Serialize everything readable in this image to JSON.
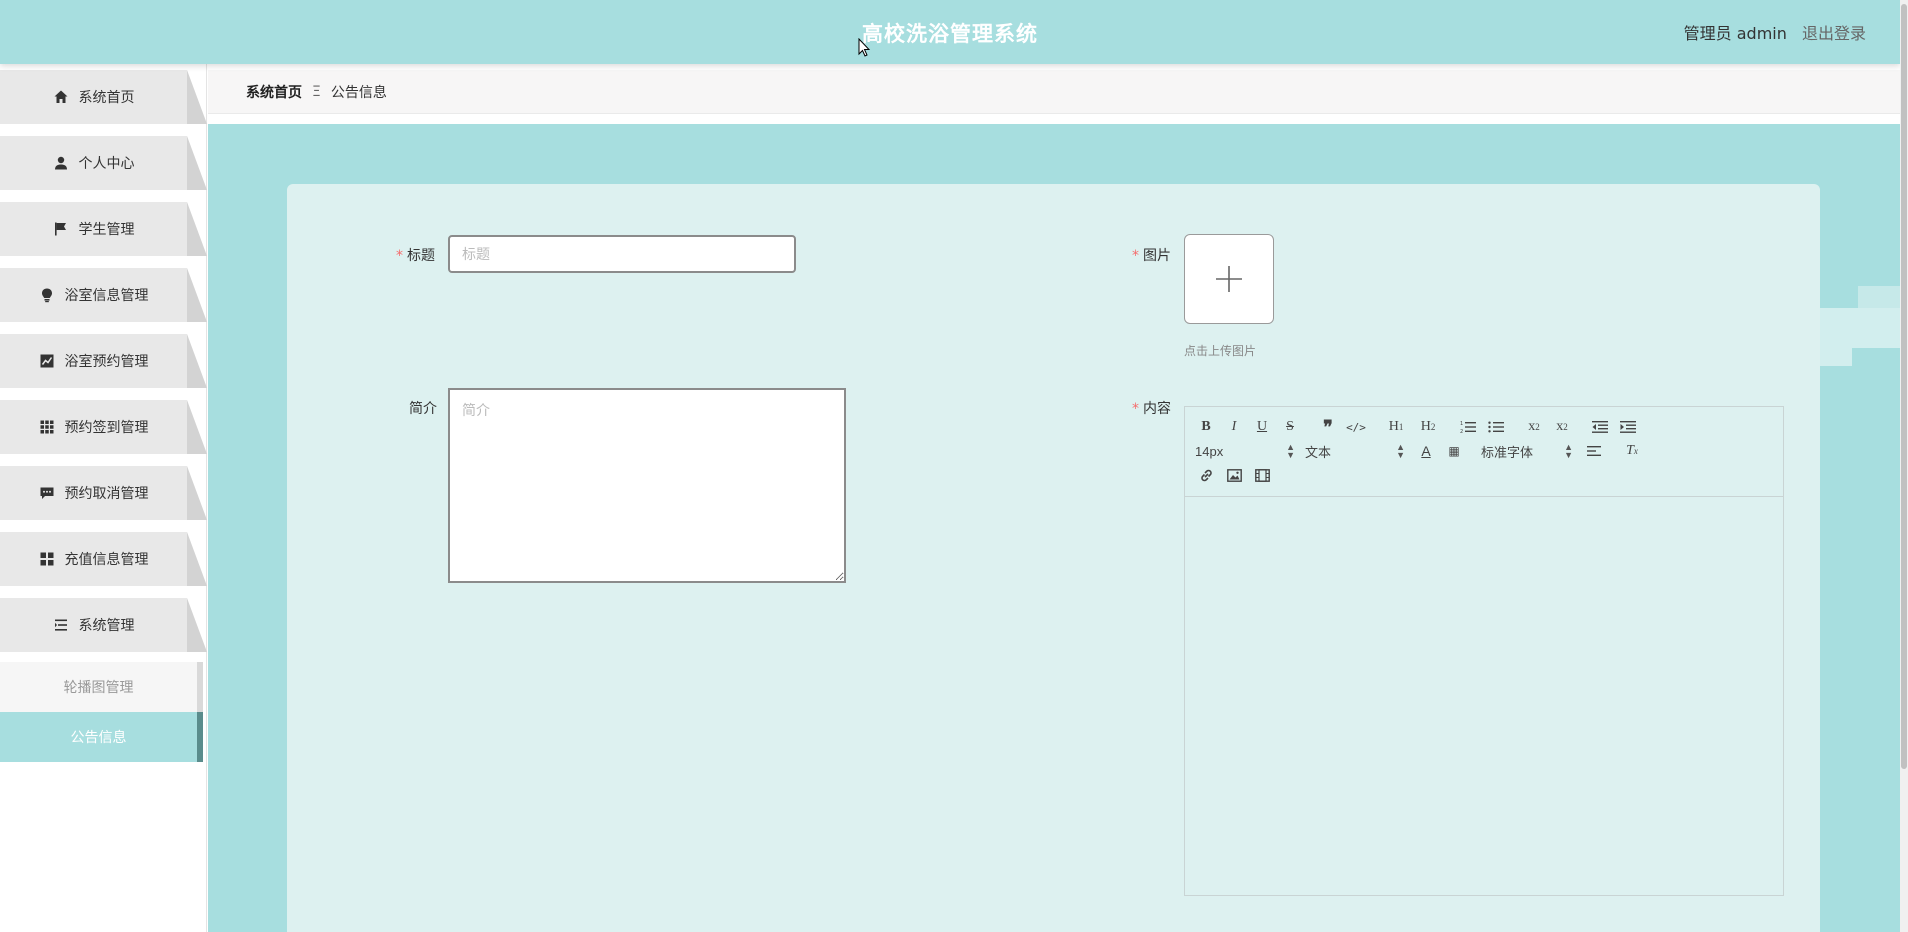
{
  "header": {
    "title": "高校洗浴管理系统",
    "user_label": "管理员 admin",
    "logout_label": "退出登录"
  },
  "sidebar": {
    "items": [
      {
        "label": "系统首页",
        "icon": "home-icon"
      },
      {
        "label": "个人中心",
        "icon": "user-icon"
      },
      {
        "label": "学生管理",
        "icon": "flag-icon"
      },
      {
        "label": "浴室信息管理",
        "icon": "bulb-icon"
      },
      {
        "label": "浴室预约管理",
        "icon": "chart-icon"
      },
      {
        "label": "预约签到管理",
        "icon": "grid-icon"
      },
      {
        "label": "预约取消管理",
        "icon": "comment-icon"
      },
      {
        "label": "充值信息管理",
        "icon": "apps-icon"
      },
      {
        "label": "系统管理",
        "icon": "list-icon"
      }
    ],
    "submenu": [
      {
        "label": "轮播图管理"
      },
      {
        "label": "公告信息"
      }
    ]
  },
  "breadcrumb": {
    "home": "系统首页",
    "separator": "Ξ",
    "current": "公告信息"
  },
  "form": {
    "title_label": "标题",
    "title_placeholder": "标题",
    "summary_label": "简介",
    "summary_placeholder": "简介",
    "image_label": "图片",
    "upload_hint": "点击上传图片",
    "content_label": "内容"
  },
  "editor": {
    "font_size": "14px",
    "header_select": "文本",
    "font_family": "标准字体"
  },
  "colors": {
    "theme": "#a7dedf",
    "card": "#ddf1f0",
    "active_item_border": "#5a8c8c",
    "required": "#f56c6c"
  }
}
